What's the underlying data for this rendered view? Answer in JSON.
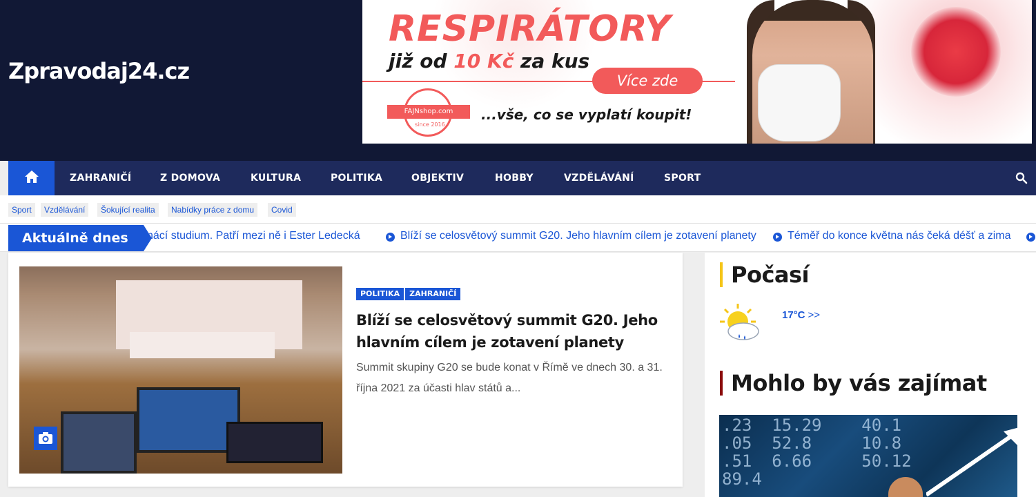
{
  "site": {
    "title": "Zpravodaj24.cz"
  },
  "ad": {
    "headline": "RESPIRÁTORY",
    "sub_prefix": "již od ",
    "sub_price": "10 Kč",
    "sub_suffix": " za kus",
    "button": "Více zde",
    "logo_text": "FAJNshop.com",
    "logo_since": "since 2016",
    "tagline": "...vše, co se vyplatí koupit!"
  },
  "nav": {
    "home_icon": "home-icon",
    "items": [
      "ZAHRANIČÍ",
      "Z DOMOVA",
      "KULTURA",
      "POLITIKA",
      "OBJEKTIV",
      "HOBBY",
      "VZDĚLÁVÁNÍ",
      "SPORT"
    ],
    "search_icon": "search-icon"
  },
  "tags": [
    "Sport",
    "Vzdělávání",
    "Šokující realita",
    "Nabídky práce z domu",
    "Covid"
  ],
  "ticker": {
    "label": "Aktuálně dnes",
    "items": [
      "nácí studium. Patří mezi ně i Ester Ledecká",
      "Blíží se celosvětový summit G20. Jeho hlavním cílem je zotavení planety",
      "Téměř do konce května nás čeká déšť a zima"
    ]
  },
  "post": {
    "categories": [
      "POLITIKA",
      "ZAHRANIČÍ"
    ],
    "title": "Blíží se celosvětový summit G20. Jeho hlavním cílem je zotavení planety",
    "excerpt": "Summit skupiny G20 se bude konat v Římě ve dnech 30. a 31. října 2021 za účasti hlav států a...",
    "image_icon": "camera-icon"
  },
  "sidebar": {
    "weather_title": "Počasí",
    "temperature": "17°C",
    "more": ">>",
    "weather_icon": "sun-cloud-rain-icon",
    "related_title": "Mohlo by vás zajímat"
  },
  "colors": {
    "header_bg": "#111835",
    "nav_bg": "#1e2a5c",
    "accent": "#1a56d6",
    "ad_red": "#f25a5a"
  }
}
